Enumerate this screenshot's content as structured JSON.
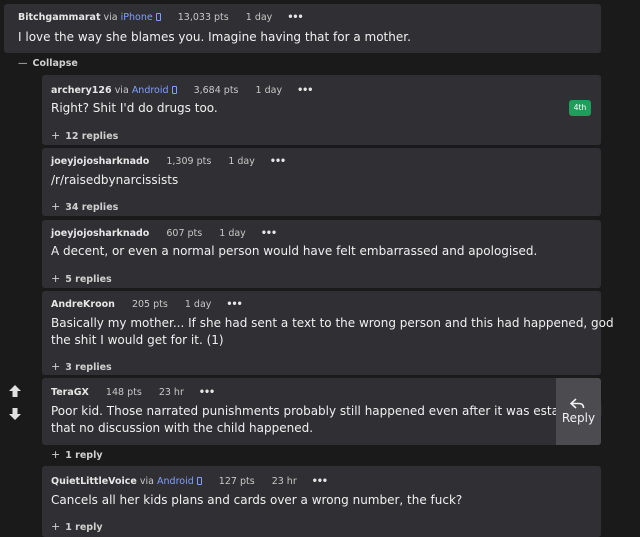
{
  "header": {
    "user": "Bitchgammarat",
    "via": "via",
    "device": "iPhone",
    "pts": "13,033 pts",
    "age": "1 day",
    "dots": "•••",
    "body": "I love the way she blames you. Imagine having that for a mother.",
    "collapse_label": "Collapse"
  },
  "comments": [
    {
      "user": "archery126",
      "via": "via",
      "device": "Android",
      "pts": "3,684 pts",
      "age": "1 day",
      "dots": "•••",
      "body": "Right? Shit I'd do drugs too.",
      "badge": "4th",
      "replies": "12 replies"
    },
    {
      "user": "joeyjojosharknado",
      "pts": "1,309 pts",
      "age": "1 day",
      "dots": "•••",
      "body": "/r/raisedbynarcissists",
      "replies": "34 replies"
    },
    {
      "user": "joeyjojosharknado",
      "pts": "607 pts",
      "age": "1 day",
      "dots": "•••",
      "body": "A decent, or even a normal person would have felt embarrassed and apologised.",
      "replies": "5 replies"
    },
    {
      "user": "AndreKroon",
      "pts": "205 pts",
      "age": "1 day",
      "dots": "•••",
      "body_line1": "Basically my mother... If she had sent a text to the wrong person and this had happened, god",
      "body_line2": "the shit I would get for it. (1)",
      "replies": "3 replies"
    },
    {
      "user": "TeraGX",
      "pts": "148 pts",
      "age": "23 hr",
      "dots": "•••",
      "body_line1": "Poor kid. Those narrated punishments probably still happened even after it was established",
      "body_line2": "that no discussion with the child happened.",
      "replies": "1 reply",
      "reply_label": "Reply"
    },
    {
      "user": "QuietLittleVoice",
      "via": "via",
      "device": "Android",
      "pts": "127 pts",
      "age": "23 hr",
      "dots": "•••",
      "body": "Cancels all her kids plans and cards over a wrong number, the fuck?",
      "replies": "1 reply"
    }
  ],
  "icons": {
    "upvote": "arrow-up-icon",
    "downvote": "arrow-down-icon",
    "reply": "reply-arrow-icon",
    "device": "phone-icon"
  },
  "colors": {
    "background": "#1a1a1b",
    "card": "#303034",
    "device_link": "#7f9fff",
    "badge": "#1e9e5a",
    "reply_button": "#4b4b50"
  }
}
